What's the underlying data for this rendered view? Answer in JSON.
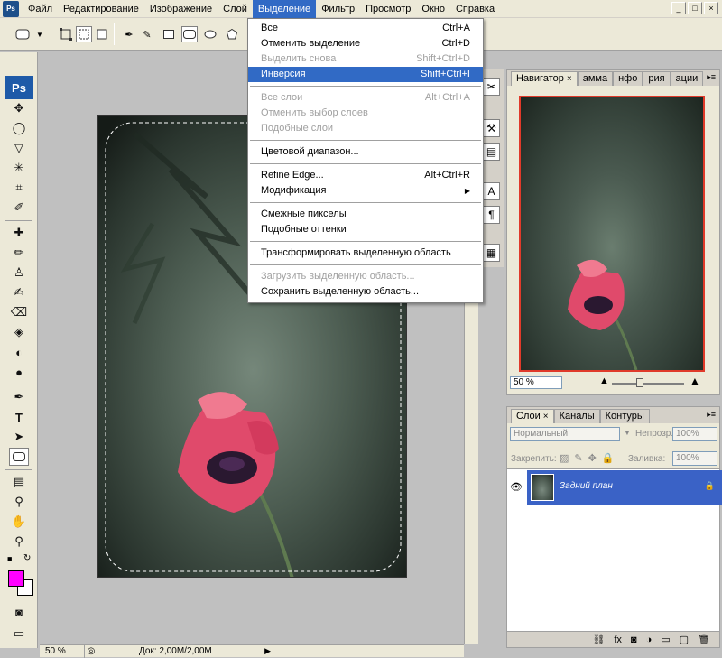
{
  "app": {
    "logo": "Ps"
  },
  "menubar": {
    "items": [
      "Файл",
      "Редактирование",
      "Изображение",
      "Слой",
      "Выделение",
      "Фильтр",
      "Просмотр",
      "Окно",
      "Справка"
    ],
    "active_index": 4,
    "window_controls": [
      "_",
      "□",
      "×"
    ]
  },
  "dropdown": {
    "items": [
      {
        "label": "Все",
        "shortcut": "Ctrl+A",
        "disabled": false
      },
      {
        "label": "Отменить выделение",
        "shortcut": "Ctrl+D",
        "disabled": false
      },
      {
        "label": "Выделить снова",
        "shortcut": "Shift+Ctrl+D",
        "disabled": true
      },
      {
        "label": "Инверсия",
        "shortcut": "Shift+Ctrl+I",
        "disabled": false,
        "highlight": true
      },
      {
        "sep": true
      },
      {
        "label": "Все слои",
        "shortcut": "Alt+Ctrl+A",
        "disabled": true
      },
      {
        "label": "Отменить выбор слоев",
        "shortcut": "",
        "disabled": true
      },
      {
        "label": "Подобные слои",
        "shortcut": "",
        "disabled": true
      },
      {
        "sep": true
      },
      {
        "label": "Цветовой диапазон...",
        "shortcut": "",
        "disabled": false
      },
      {
        "sep": true
      },
      {
        "label": "Refine Edge...",
        "shortcut": "Alt+Ctrl+R",
        "disabled": false
      },
      {
        "label": "Модификация",
        "shortcut": "",
        "disabled": false,
        "submenu": true
      },
      {
        "sep": true
      },
      {
        "label": "Смежные пикселы",
        "shortcut": "",
        "disabled": false
      },
      {
        "label": "Подобные оттенки",
        "shortcut": "",
        "disabled": false
      },
      {
        "sep": true
      },
      {
        "label": "Трансформировать выделенную область",
        "shortcut": "",
        "disabled": false
      },
      {
        "sep": true
      },
      {
        "label": "Загрузить выделенную область...",
        "shortcut": "",
        "disabled": true
      },
      {
        "label": "Сохранить выделенную область...",
        "shortcut": "",
        "disabled": false
      }
    ]
  },
  "statusbar": {
    "zoom": "50 %",
    "doc_info": "Док: 2,00M/2,00M"
  },
  "navigator": {
    "tabs": [
      "Навигатор",
      "амма",
      "нфо",
      "рия",
      "ации"
    ],
    "zoom": "50 %"
  },
  "layers_panel": {
    "tabs": [
      "Слои",
      "Каналы",
      "Контуры"
    ],
    "blend_mode": "Нормальный",
    "opacity_label": "Непрозр.:",
    "opacity_value": "100%",
    "lock_label": "Закрепить:",
    "fill_label": "Заливка:",
    "fill_value": "100%",
    "layer_name": "Задний план"
  },
  "colors": {
    "foreground": "#ff00ff",
    "background": "#ffffff",
    "selection": "#316ac5"
  }
}
